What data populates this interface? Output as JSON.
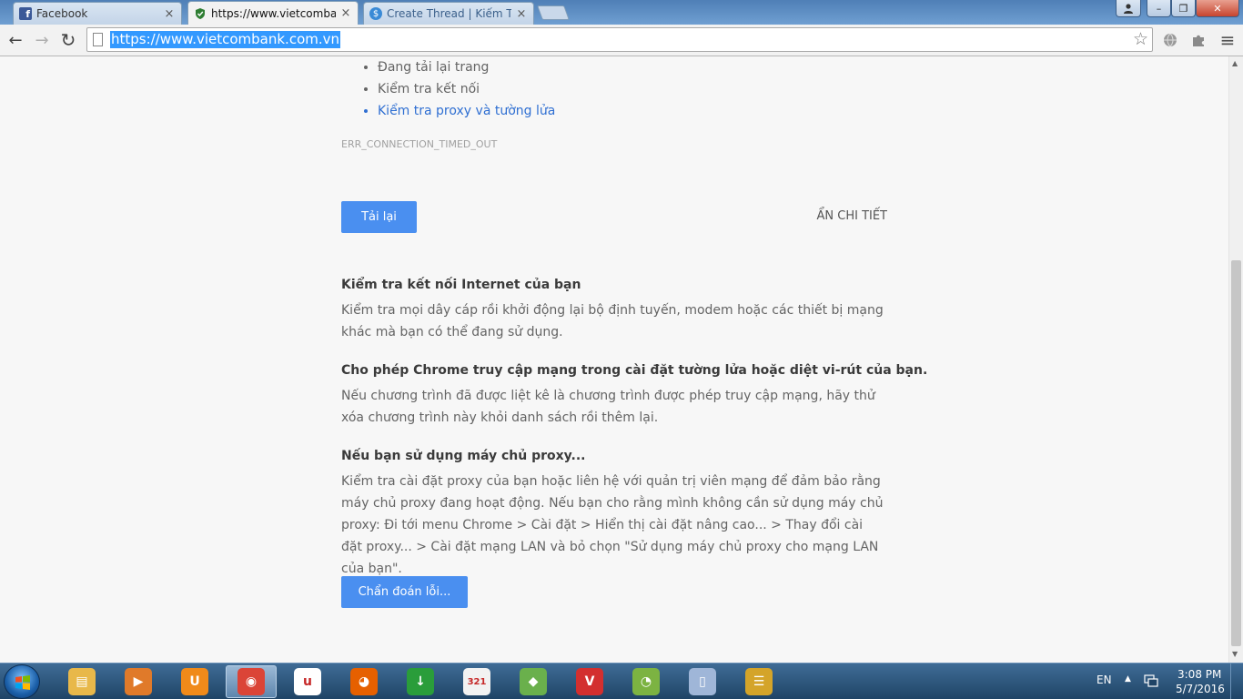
{
  "browser": {
    "tabs": [
      {
        "label": "Facebook",
        "close": "×"
      },
      {
        "label": "https://www.vietcombank.",
        "close": "×"
      },
      {
        "label": "Create Thread | Kiếm Tiền",
        "close": "×"
      }
    ],
    "window_controls": {
      "minimize": "–",
      "maximize": "❐",
      "close": "✕"
    },
    "nav": {
      "back": "←",
      "forward": "→",
      "reload": "↻"
    },
    "address": {
      "url": "https://www.vietcombank.com.vn",
      "bookmark_star": "☆"
    },
    "menu_icon": "≡"
  },
  "page": {
    "suggestions": [
      "Đang tải lại trang",
      "Kiểm tra kết nối",
      "Kiểm tra proxy và tường lửa"
    ],
    "error_code": "ERR_CONNECTION_TIMED_OUT",
    "reload_button": "Tải lại",
    "hide_details": "ẨN CHI TIẾT",
    "sections": [
      {
        "title": "Kiểm tra kết nối Internet của bạn",
        "body": "Kiểm tra mọi dây cáp rồi khởi động lại bộ định tuyến, modem hoặc các thiết bị mạng khác mà bạn có thể đang sử dụng."
      },
      {
        "title": "Cho phép Chrome truy cập mạng trong cài đặt tường lửa hoặc diệt vi-rút của bạn.",
        "body": "Nếu chương trình đã được liệt kê là chương trình được phép truy cập mạng, hãy thử xóa chương trình này khỏi danh sách rồi thêm lại."
      },
      {
        "title": "Nếu bạn sử dụng máy chủ proxy...",
        "body": "Kiểm tra cài đặt proxy của bạn hoặc liên hệ với quản trị viên mạng để đảm bảo rằng máy chủ proxy đang hoạt động. Nếu bạn cho rằng mình không cần sử dụng máy chủ proxy: Đi tới menu Chrome > Cài đặt > Hiển thị cài đặt nâng cao... > Thay đổi cài đặt proxy... > Cài đặt mạng LAN và bỏ chọn \"Sử dụng máy chủ proxy cho mạng LAN của bạn\"."
      }
    ],
    "diagnose_button": "Chẩn đoán lỗi..."
  },
  "taskbar": {
    "language": "EN",
    "time": "3:08 PM",
    "date": "5/7/2016",
    "apps": [
      {
        "name": "file-explorer",
        "color": "#e8b84a",
        "glyph": "▤"
      },
      {
        "name": "media-player",
        "color": "#e07a2a",
        "glyph": "▶"
      },
      {
        "name": "uc-browser",
        "color": "#f08a1a",
        "glyph": "U"
      },
      {
        "name": "chrome",
        "color": "#db4437",
        "glyph": "◉"
      },
      {
        "name": "unikey",
        "color": "#ffffff",
        "glyph": "u"
      },
      {
        "name": "firefox",
        "color": "#e66000",
        "glyph": "◕"
      },
      {
        "name": "idm",
        "color": "#2a9d3a",
        "glyph": "↓"
      },
      {
        "name": "calendar-321",
        "color": "#f2f2f2",
        "glyph": "321"
      },
      {
        "name": "bluestacks",
        "color": "#6ab04c",
        "glyph": "◆"
      },
      {
        "name": "vivaldi",
        "color": "#d32f2f",
        "glyph": "V"
      },
      {
        "name": "coccoc",
        "color": "#7cb342",
        "glyph": "◔"
      },
      {
        "name": "device-app",
        "color": "#9fb6d8",
        "glyph": "▯"
      },
      {
        "name": "database",
        "color": "#d4a429",
        "glyph": "☰"
      }
    ]
  }
}
